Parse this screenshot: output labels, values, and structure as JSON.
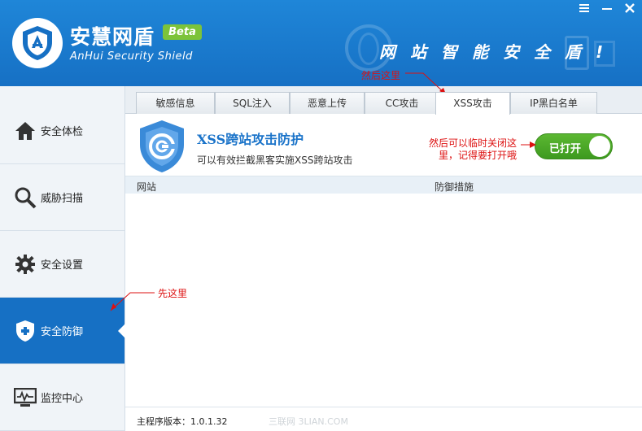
{
  "header": {
    "title": "安慧网盾",
    "badge": "Beta",
    "subtitle": "AnHui Security Shield",
    "slogan": "网站智能安全盾!",
    "menu_icon": "menu-icon",
    "close_icon": "close-icon",
    "minimize_icon": "minimize-icon"
  },
  "sidebar": {
    "items": [
      {
        "label": "安全体检",
        "icon": "home-icon"
      },
      {
        "label": "威胁扫描",
        "icon": "magnifier-icon"
      },
      {
        "label": "安全设置",
        "icon": "gear-icon"
      },
      {
        "label": "安全防御",
        "icon": "shield-icon",
        "active": true
      },
      {
        "label": "监控中心",
        "icon": "monitor-icon"
      }
    ]
  },
  "tabs": [
    {
      "label": "敏感信息"
    },
    {
      "label": "SQL注入"
    },
    {
      "label": "恶意上传"
    },
    {
      "label": "CC攻击"
    },
    {
      "label": "XSS攻击",
      "active": true
    },
    {
      "label": "IP黑白名单"
    }
  ],
  "feature": {
    "title": "XSS跨站攻击防护",
    "description": "可以有效拦截黑客实施XSS跨站攻击",
    "toggle_label": "已打开"
  },
  "table": {
    "columns": [
      "网站",
      "防御措施"
    ]
  },
  "footer": {
    "version": "主程序版本：1.0.1.32",
    "watermark": "三联网 3LIAN.COM"
  },
  "annotations": {
    "step1": "先这里",
    "step2": "然后这里",
    "step3_line1": "然后可以临时关闭这",
    "step3_line2": "里，记得要打开哦"
  },
  "colors": {
    "brand": "#1670c4",
    "toggle_on": "#4aa726",
    "annotation": "#dd1111"
  }
}
